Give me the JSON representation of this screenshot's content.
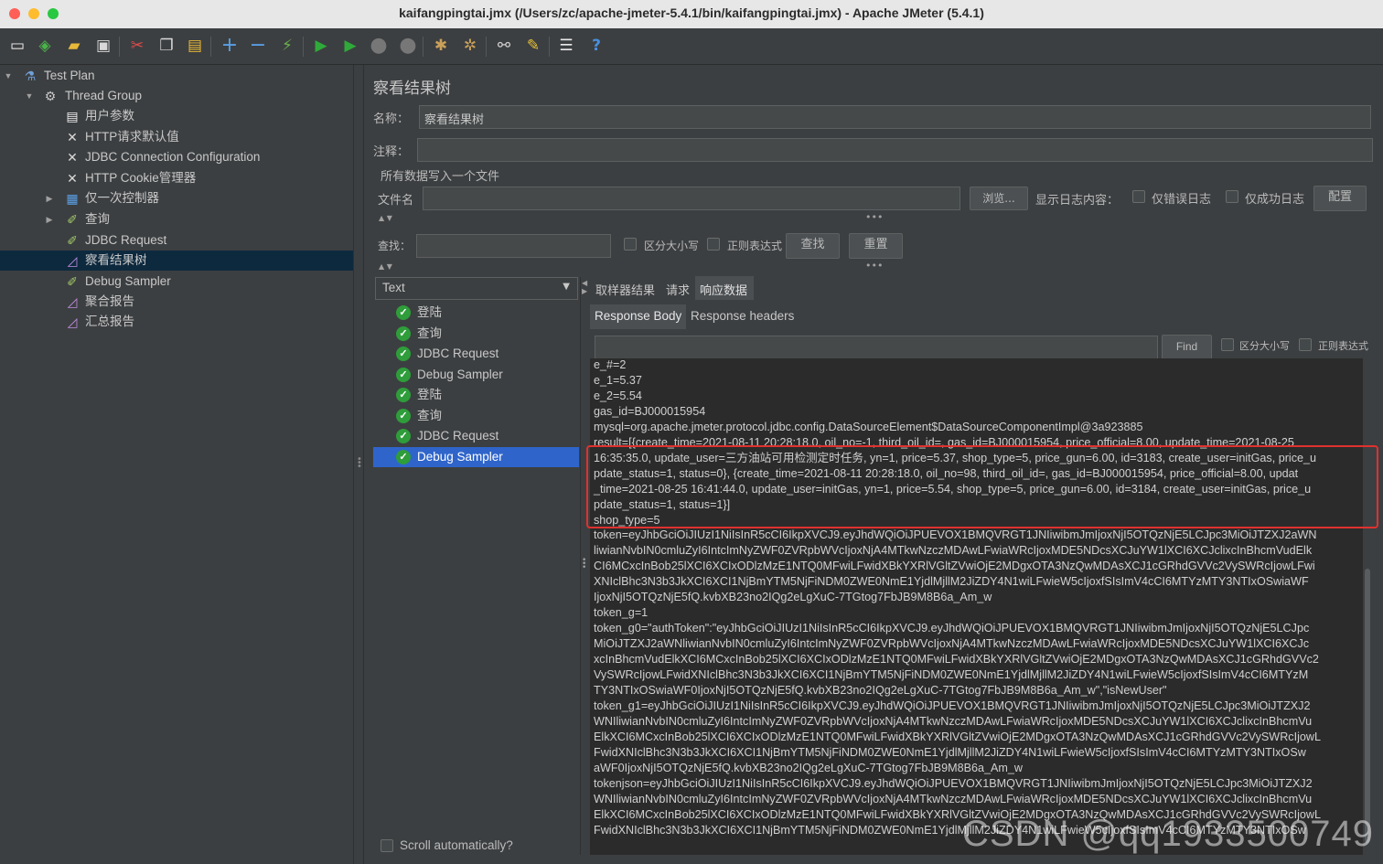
{
  "window": {
    "title": "kaifangpingtai.jmx (/Users/zc/apache-jmeter-5.4.1/bin/kaifangpingtai.jmx) - Apache JMeter (5.4.1)"
  },
  "toolbar": {
    "icons": [
      "new-icon",
      "templates-icon",
      "open-icon",
      "save-icon",
      "cut-icon",
      "copy-icon",
      "paste-icon",
      "expand-icon",
      "collapse-icon",
      "toggle-icon",
      "start-icon",
      "start-no-pause-icon",
      "stop-icon",
      "shutdown-icon",
      "clear-icon",
      "clear-all-icon",
      "search-icon",
      "reset-search-icon",
      "function-helper-icon",
      "help-icon"
    ]
  },
  "tree": {
    "items": [
      {
        "label": "Test Plan",
        "icon": "test-plan-icon"
      },
      {
        "label": "Thread Group",
        "icon": "gear-icon"
      },
      {
        "label": "用户参数",
        "icon": "user-params-icon"
      },
      {
        "label": "HTTP请求默认值",
        "icon": "config-icon"
      },
      {
        "label": "JDBC Connection Configuration",
        "icon": "config-icon"
      },
      {
        "label": "HTTP Cookie管理器",
        "icon": "config-icon"
      },
      {
        "label": "仅一次控制器",
        "icon": "controller-icon"
      },
      {
        "label": "查询",
        "icon": "sampler-icon"
      },
      {
        "label": "JDBC Request",
        "icon": "sampler-icon"
      },
      {
        "label": "察看结果树",
        "icon": "listener-icon"
      },
      {
        "label": "Debug Sampler",
        "icon": "sampler-icon"
      },
      {
        "label": "聚合报告",
        "icon": "listener-icon"
      },
      {
        "label": "汇总报告",
        "icon": "listener-icon"
      }
    ]
  },
  "panel": {
    "title": "察看结果树",
    "name_label": "名称：",
    "name_value": "察看结果树",
    "comment_label": "注释：",
    "comment_value": "",
    "write_all_label": "所有数据写入一个文件",
    "filename_label": "文件名",
    "filename_value": "",
    "browse_button": "浏览...",
    "log_content_label": "显示日志内容：",
    "errors_only_label": "仅错误日志",
    "success_only_label": "仅成功日志",
    "configure_button": "配置",
    "search_label": "查找：",
    "search_value": "",
    "case_sensitive_label": "区分大小写",
    "regex_label": "正则表达式",
    "find_button": "查找",
    "reset_button": "重置"
  },
  "renderer": {
    "selected": "Text"
  },
  "results": {
    "items": [
      {
        "label": "登陆"
      },
      {
        "label": "查询"
      },
      {
        "label": "JDBC Request"
      },
      {
        "label": "Debug Sampler"
      },
      {
        "label": "登陆"
      },
      {
        "label": "查询"
      },
      {
        "label": "JDBC Request"
      },
      {
        "label": "Debug Sampler"
      }
    ],
    "scroll_auto_label": "Scroll automatically?"
  },
  "detail_tabs": {
    "sampler_result": "取样器结果",
    "request": "请求",
    "response_data": "响应数据"
  },
  "response_tabs": {
    "body": "Response Body",
    "headers": "Response headers"
  },
  "response_search": {
    "value": "",
    "find_button": "Find",
    "case_label": "区分大小写",
    "regex_label": "正则表达式"
  },
  "response_lines": [
    "e_#=2",
    "e_1=5.37",
    "e_2=5.54",
    "gas_id=BJ000015954",
    "mysql=org.apache.jmeter.protocol.jdbc.config.DataSourceElement$DataSourceComponentImpl@3a923885",
    "result=[{create_time=2021-08-11 20:28:18.0, oil_no=-1, third_oil_id=, gas_id=BJ000015954, price_official=8.00, update_time=2021-08-25",
    "16:35:35.0, update_user=三方油站可用检测定时任务, yn=1, price=5.37, shop_type=5, price_gun=6.00, id=3183, create_user=initGas, price_u",
    "pdate_status=1, status=0}, {create_time=2021-08-11 20:28:18.0, oil_no=98, third_oil_id=, gas_id=BJ000015954, price_official=8.00, updat",
    "_time=2021-08-25 16:41:44.0, update_user=initGas, yn=1, price=5.54, shop_type=5, price_gun=6.00, id=3184, create_user=initGas, price_u",
    "pdate_status=1, status=1}]",
    "shop_type=5",
    "token=eyJhbGciOiJIUzI1NiIsInR5cCI6IkpXVCJ9.eyJhdWQiOiJPUEVOX1BMQVRGT1JNIiwibmJmIjoxNjI5OTQzNjE5LCJpc3MiOiJTZXJ2aWN",
    "liwianNvbIN0cmluZyI6IntcImNyZWF0ZVRpbWVcIjoxNjA4MTkwNzczMDAwLFwiaWRcIjoxMDE5NDcsXCJuYW1lXCI6XCJclixcInBhcmVudElk",
    "CI6MCxcInBob25lXCI6XCIxODlzMzE1NTQ0MFwiLFwidXBkYXRlVGltZVwiOjE2MDgxOTA3NzQwMDAsXCJ1cGRhdGVVc2VySWRcIjowLFwi",
    "XNIclBhc3N3b3JkXCI6XCI1NjBmYTM5NjFiNDM0ZWE0NmE1YjdlMjllM2JiZDY4N1wiLFwieW5cIjoxfSIsImV4cCI6MTYzMTY3NTIxOSwiaWF",
    "IjoxNjI5OTQzNjE5fQ.kvbXB23no2IQg2eLgXuC-7TGtog7FbJB9M8B6a_Am_w",
    "token_g=1",
    "token_g0=\"authToken\":\"eyJhbGciOiJIUzI1NiIsInR5cCI6IkpXVCJ9.eyJhdWQiOiJPUEVOX1BMQVRGT1JNIiwibmJmIjoxNjI5OTQzNjE5LCJpc",
    "MiOiJTZXJ2aWNliwianNvbIN0cmluZyI6IntcImNyZWF0ZVRpbWVcIjoxNjA4MTkwNzczMDAwLFwiaWRcIjoxMDE5NDcsXCJuYW1lXCI6XCJc",
    "xcInBhcmVudElkXCI6MCxcInBob25lXCI6XCIxODlzMzE1NTQ0MFwiLFwidXBkYXRlVGltZVwiOjE2MDgxOTA3NzQwMDAsXCJ1cGRhdGVVc2",
    "VySWRcIjowLFwidXNIclBhc3N3b3JkXCI6XCI1NjBmYTM5NjFiNDM0ZWE0NmE1YjdlMjllM2JiZDY4N1wiLFwieW5cIjoxfSIsImV4cCI6MTYzM",
    "TY3NTIxOSwiaWF0IjoxNjI5OTQzNjE5fQ.kvbXB23no2IQg2eLgXuC-7TGtog7FbJB9M8B6a_Am_w\",\"isNewUser\"",
    "token_g1=eyJhbGciOiJIUzI1NiIsInR5cCI6IkpXVCJ9.eyJhdWQiOiJPUEVOX1BMQVRGT1JNIiwibmJmIjoxNjI5OTQzNjE5LCJpc3MiOiJTZXJ2",
    "WNIliwianNvbIN0cmluZyI6IntcImNyZWF0ZVRpbWVcIjoxNjA4MTkwNzczMDAwLFwiaWRcIjoxMDE5NDcsXCJuYW1lXCI6XCJclixcInBhcmVu",
    "ElkXCI6MCxcInBob25lXCI6XCIxODlzMzE1NTQ0MFwiLFwidXBkYXRlVGltZVwiOjE2MDgxOTA3NzQwMDAsXCJ1cGRhdGVVc2VySWRcIjowL",
    "FwidXNIclBhc3N3b3JkXCI6XCI1NjBmYTM5NjFiNDM0ZWE0NmE1YjdlMjllM2JiZDY4N1wiLFwieW5cIjoxfSIsImV4cCI6MTYzMTY3NTIxOSw",
    "aWF0IjoxNjI5OTQzNjE5fQ.kvbXB23no2IQg2eLgXuC-7TGtog7FbJB9M8B6a_Am_w",
    "tokenjson=eyJhbGciOiJIUzI1NiIsInR5cCI6IkpXVCJ9.eyJhdWQiOiJPUEVOX1BMQVRGT1JNIiwibmJmIjoxNjI5OTQzNjE5LCJpc3MiOiJTZXJ2",
    "WNIliwianNvbIN0cmluZyI6IntcImNyZWF0ZVRpbWVcIjoxNjA4MTkwNzczMDAwLFwiaWRcIjoxMDE5NDcsXCJuYW1lXCI6XCJclixcInBhcmVu",
    "ElkXCI6MCxcInBob25lXCI6XCIxODlzMzE1NTQ0MFwiLFwidXBkYXRlVGltZVwiOjE2MDgxOTA3NzQwMDAsXCJ1cGRhdGVVc2VySWRcIjowL",
    "FwidXNIclBhc3N3b3JkXCI6XCI1NjBmYTM5NjFiNDM0ZWE0NmE1YjdlMjllM2JiZDY4N1wiLFwieW5cIjoxfSIsImV4cCI6MTYzMTY3NTIxOSw"
  ],
  "watermark": "CSDN @qq1933500749",
  "colors": {
    "background": "#3c3f41",
    "selection": "#2f65ca",
    "highlight_box": "#e0312f",
    "success": "#2e9d3a"
  }
}
